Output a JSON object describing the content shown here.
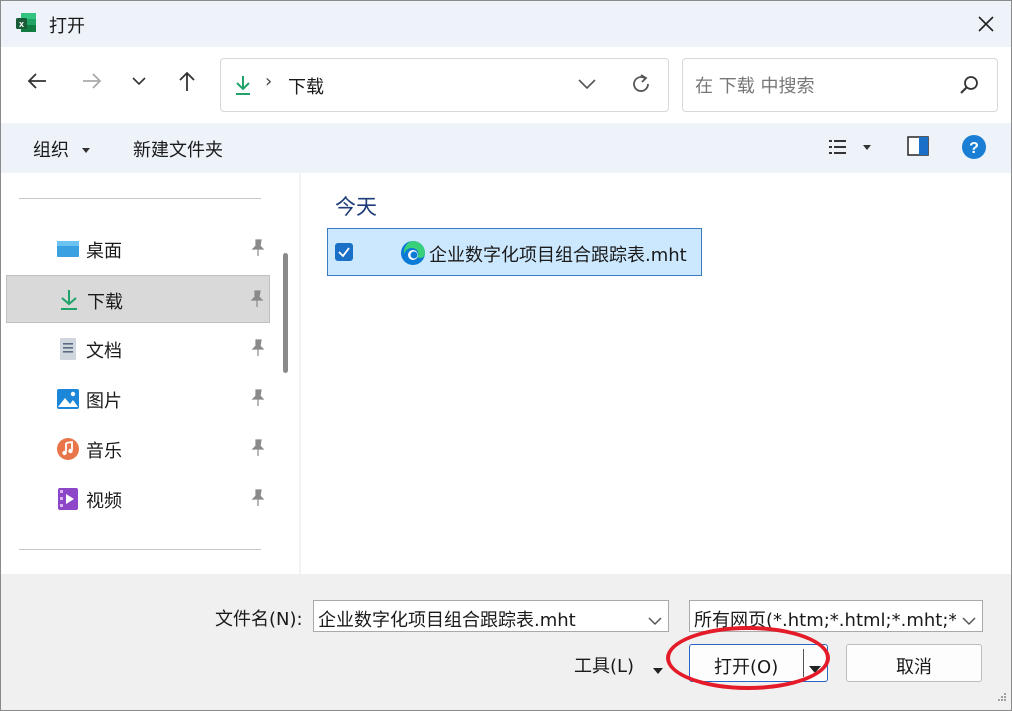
{
  "window": {
    "title": "打开",
    "close_icon": "close-icon"
  },
  "nav": {
    "location": "下载",
    "breadcrumb_separator": "›",
    "search_placeholder": "在 下载 中搜索"
  },
  "toolbar": {
    "organize": "组织",
    "new_folder": "新建文件夹"
  },
  "sidebar": {
    "items": [
      {
        "label": "桌面",
        "icon": "desktop-icon"
      },
      {
        "label": "下载",
        "icon": "download-icon",
        "selected": true
      },
      {
        "label": "文档",
        "icon": "document-icon"
      },
      {
        "label": "图片",
        "icon": "pictures-icon"
      },
      {
        "label": "音乐",
        "icon": "music-icon"
      },
      {
        "label": "视频",
        "icon": "video-icon"
      }
    ]
  },
  "content": {
    "group_header": "今天",
    "files": [
      {
        "name": "企业数字化项目组合跟踪表.mht",
        "icon": "edge-icon",
        "selected": true
      }
    ]
  },
  "bottom": {
    "filename_label": "文件名(N):",
    "filename_value": "企业数字化项目组合跟踪表.mht",
    "filetype_value": "所有网页(*.htm;*.html;*.mht;*.",
    "tools_label": "工具(L)",
    "open_label": "打开(O)",
    "cancel_label": "取消"
  },
  "colors": {
    "accent": "#1a6fc6",
    "highlight_ring": "#e41c2a",
    "selection_bg": "#cce8ff"
  }
}
